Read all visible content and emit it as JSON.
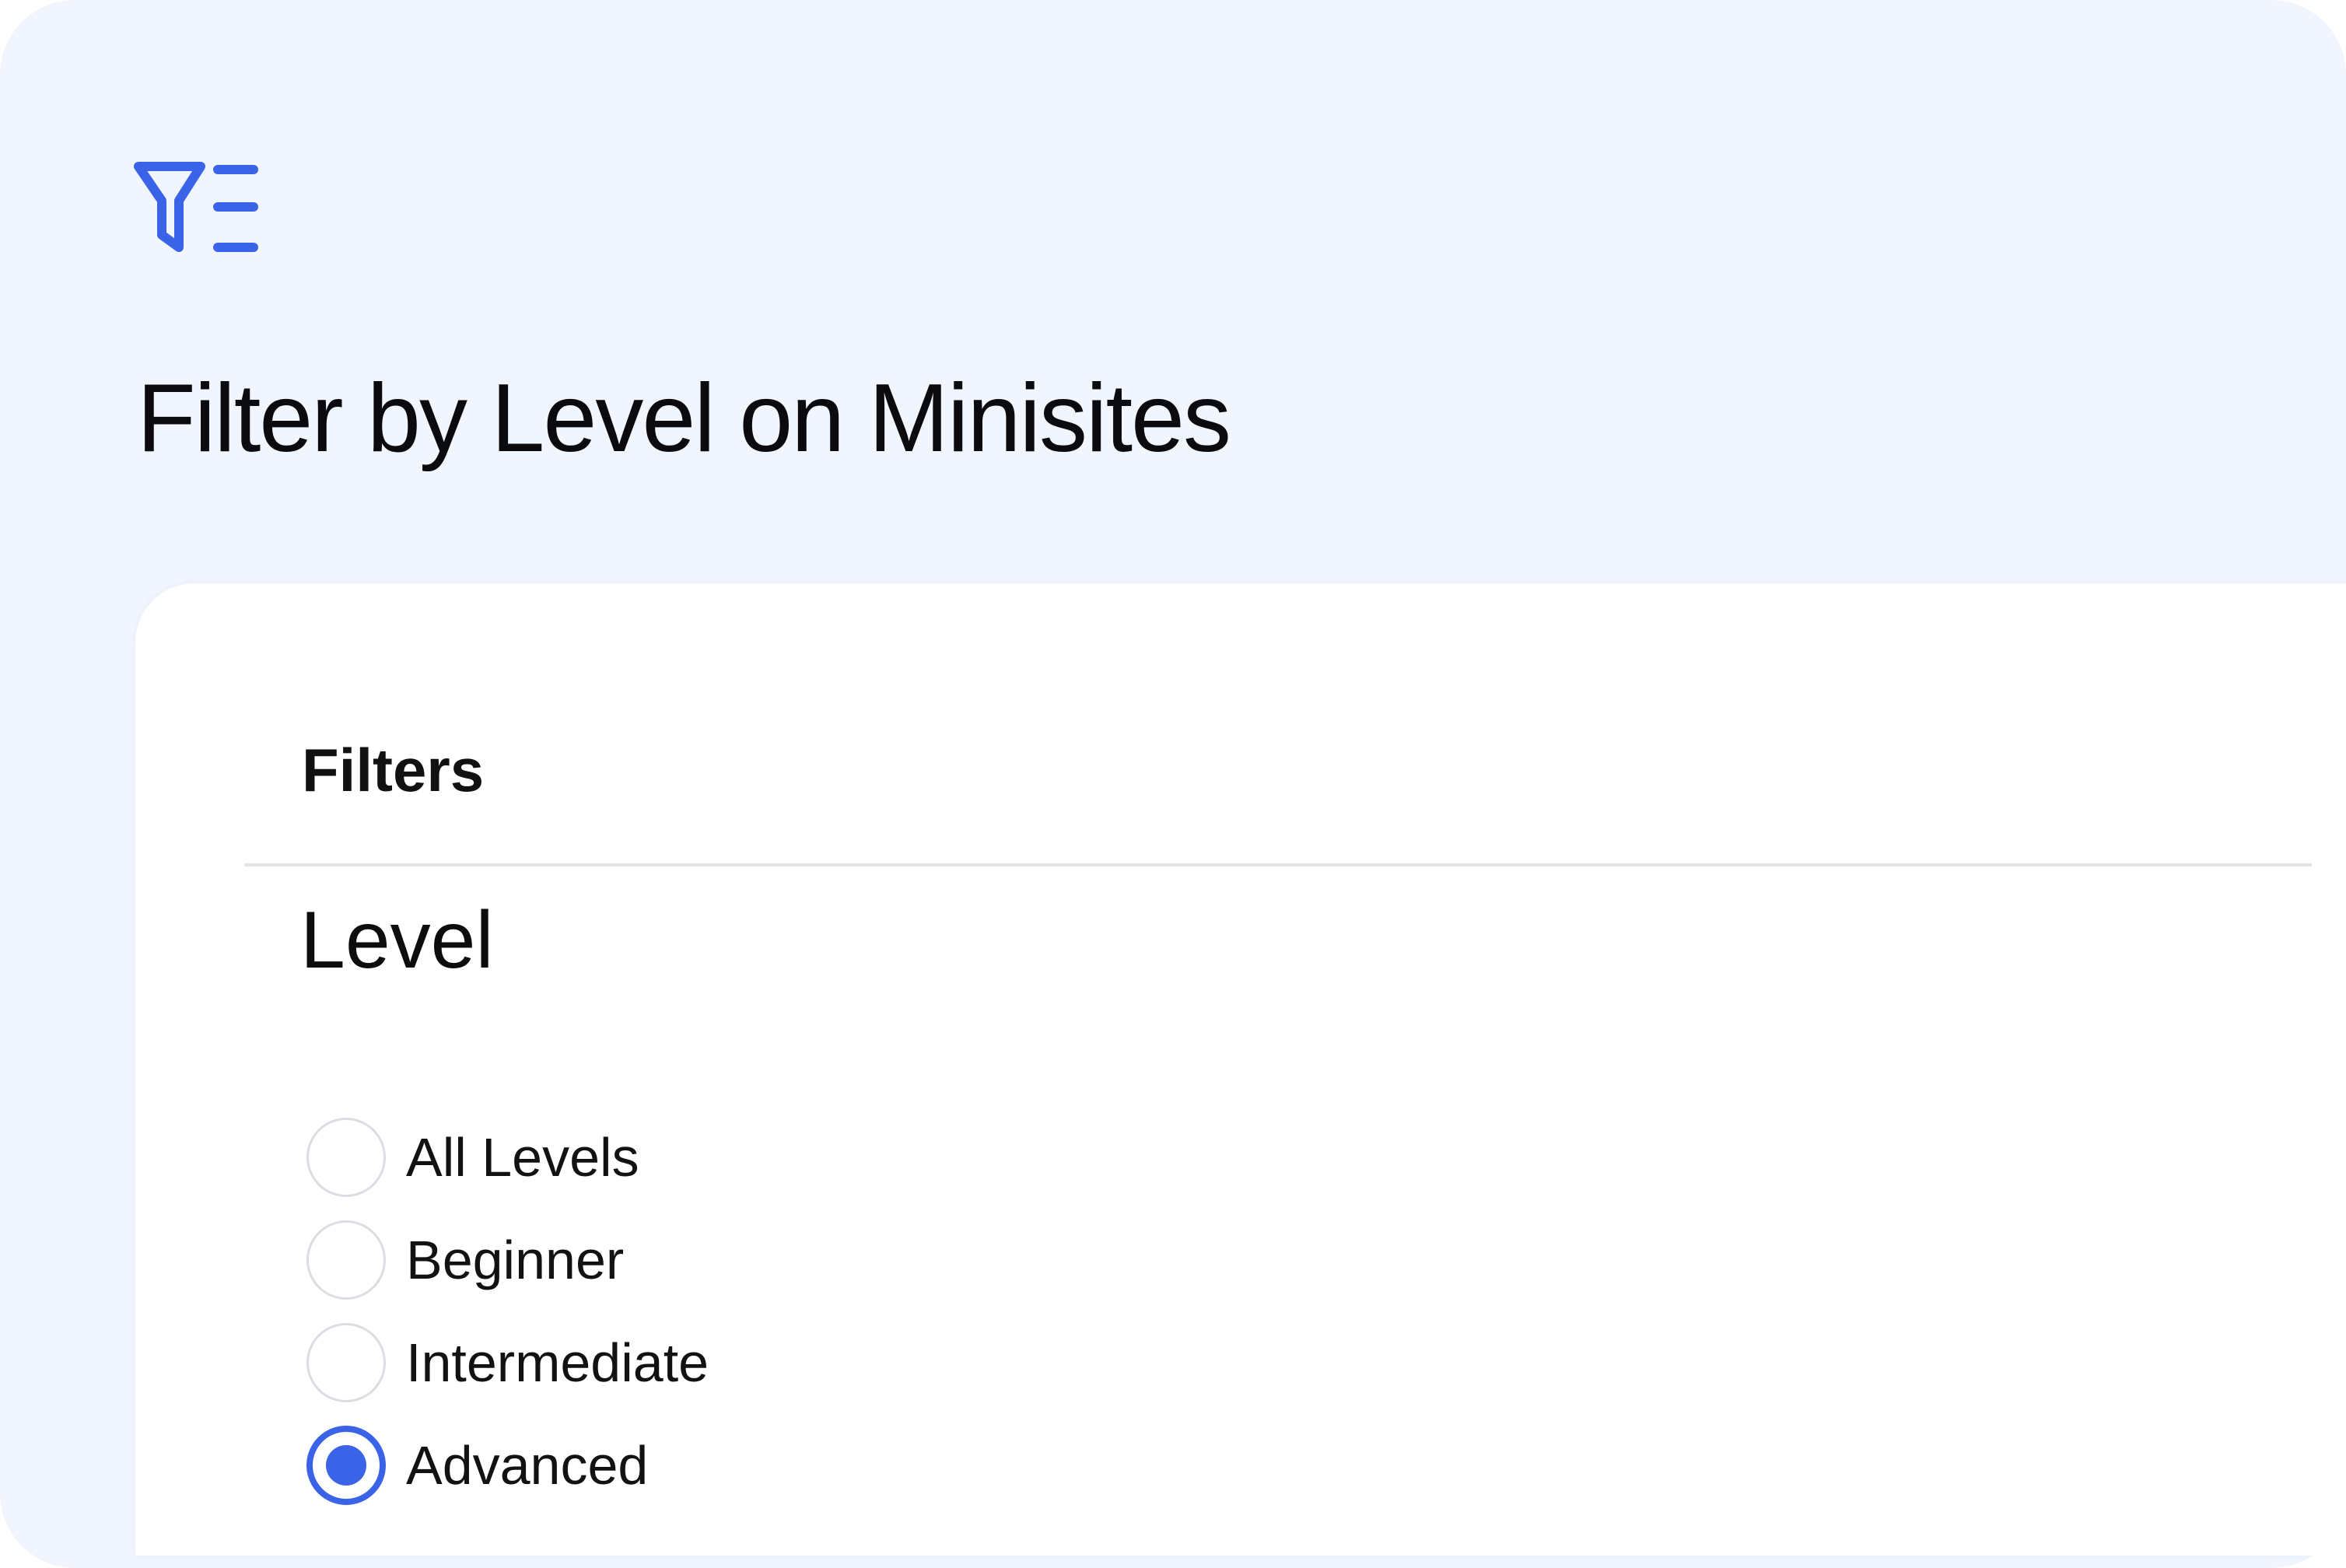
{
  "page": {
    "title": "Filter by Level on Minisites",
    "icon": "filter-list-icon",
    "accent_color": "#3b63e8",
    "background_color": "#f1f5fe"
  },
  "panel": {
    "heading": "Filters",
    "section_title": "Level",
    "options": [
      {
        "label": "All Levels",
        "selected": false
      },
      {
        "label": "Beginner",
        "selected": false
      },
      {
        "label": "Intermediate",
        "selected": false
      },
      {
        "label": "Advanced",
        "selected": true
      }
    ]
  }
}
